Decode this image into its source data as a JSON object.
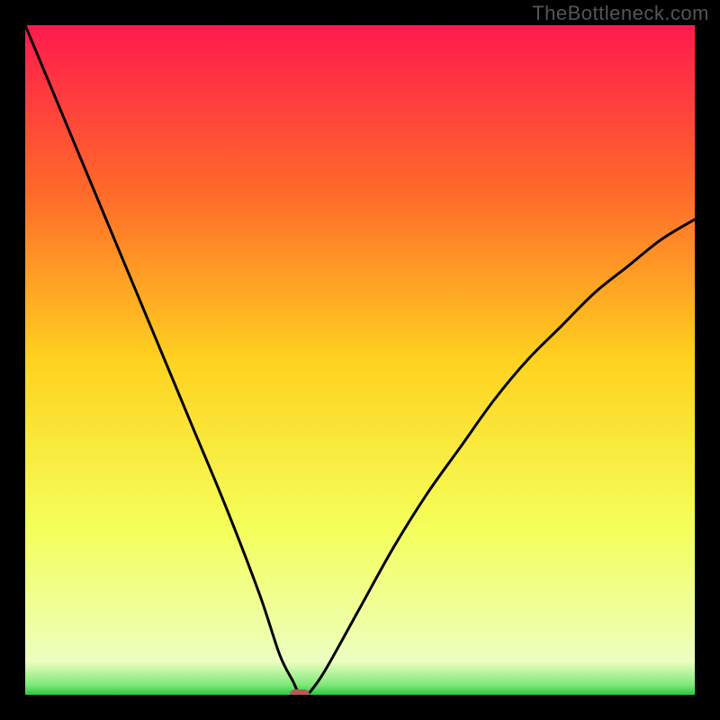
{
  "watermark": "TheBottleneck.com",
  "chart_data": {
    "type": "line",
    "title": "",
    "xlabel": "",
    "ylabel": "",
    "xlim": [
      0,
      100
    ],
    "ylim": [
      0,
      100
    ],
    "grid": false,
    "legend": false,
    "series": [
      {
        "name": "bottleneck-curve",
        "x": [
          0,
          5,
          10,
          15,
          20,
          25,
          30,
          35,
          38,
          40,
          41,
          42,
          43,
          45,
          50,
          55,
          60,
          65,
          70,
          75,
          80,
          85,
          90,
          95,
          100
        ],
        "y": [
          100,
          88,
          76,
          64,
          52,
          40,
          28,
          15,
          6,
          2,
          0,
          0,
          1,
          4,
          13,
          22,
          30,
          37,
          44,
          50,
          55,
          60,
          64,
          68,
          71
        ]
      }
    ],
    "optimal_point": {
      "x": 41,
      "y": 0
    },
    "gradient_stops": [
      {
        "offset": 0.0,
        "color": "#ff1a4d"
      },
      {
        "offset": 0.25,
        "color": "#ff6a2a"
      },
      {
        "offset": 0.5,
        "color": "#ffd21f"
      },
      {
        "offset": 0.75,
        "color": "#f4ff5a"
      },
      {
        "offset": 0.95,
        "color": "#ecffc0"
      },
      {
        "offset": 0.985,
        "color": "#7fe87a"
      },
      {
        "offset": 1.0,
        "color": "#28c840"
      }
    ],
    "marker_color": "#b75a52",
    "line_color": "#000000"
  }
}
